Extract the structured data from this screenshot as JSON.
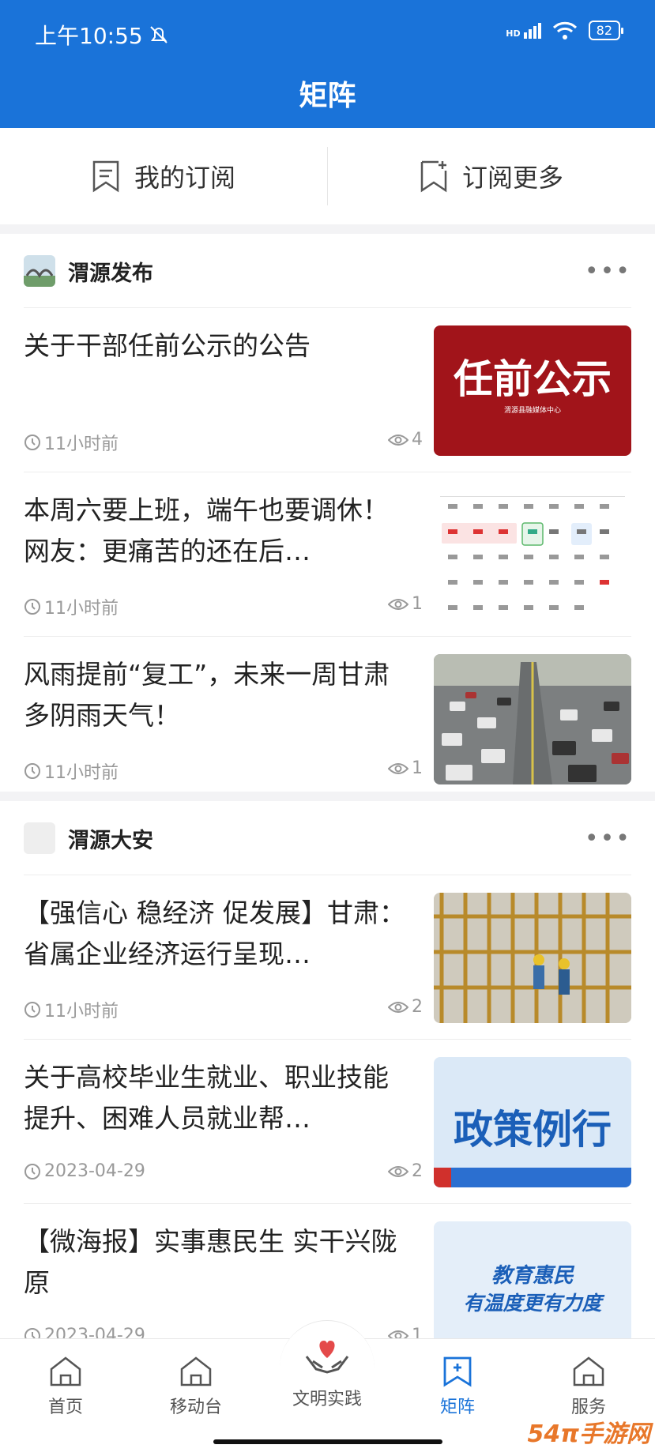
{
  "status_bar": {
    "time": "上午10:55",
    "signal": "HD",
    "battery": "82"
  },
  "page": {
    "title": "矩阵"
  },
  "subscribe_bar": {
    "my_subscriptions": "我的订阅",
    "subscribe_more": "订阅更多"
  },
  "sections": [
    {
      "name": "渭源发布",
      "more": "•••",
      "items": [
        {
          "title": "关于干部任前公示的公告",
          "time": "11小时前",
          "views": "4",
          "thumb_text": "任前公示",
          "thumb_sub": "渭源县融媒体中心"
        },
        {
          "title": "本周六要上班，端午也要调休！网友：更痛苦的还在后…",
          "time": "11小时前",
          "views": "1"
        },
        {
          "title": "风雨提前“复工”，未来一周甘肃多阴雨天气！",
          "time": "11小时前",
          "views": "1"
        }
      ]
    },
    {
      "name": "渭源大安",
      "more": "•••",
      "items": [
        {
          "title": "【强信心 稳经济 促发展】甘肃：省属企业经济运行呈现…",
          "time": "11小时前",
          "views": "2"
        },
        {
          "title": "关于高校毕业生就业、职业技能提升、困难人员就业帮…",
          "time": "2023-04-29",
          "views": "2",
          "thumb_text": "政策例行"
        },
        {
          "title": "【微海报】实事惠民生 实干兴陇原",
          "time": "2023-04-29",
          "views": "1",
          "thumb_text1": "教育惠民",
          "thumb_text2": "有温度更有力度"
        }
      ]
    }
  ],
  "tab_bar": {
    "home": "首页",
    "mobile": "移动台",
    "civilization": "文明实践",
    "matrix": "矩阵",
    "service": "服务"
  },
  "watermark": "54π手游网",
  "colors": {
    "brand": "#1a73d9",
    "active_tab": "#1a73d9"
  }
}
